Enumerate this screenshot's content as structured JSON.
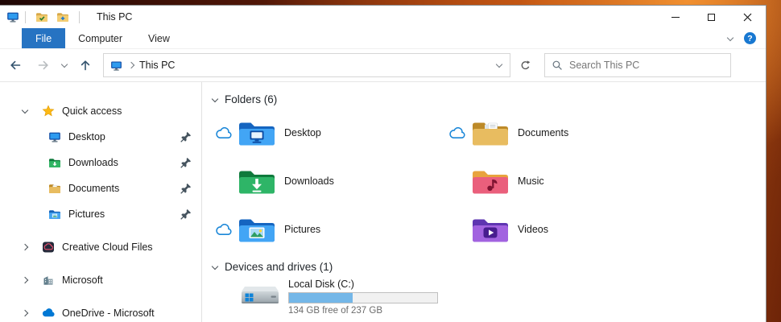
{
  "window": {
    "title": "This PC",
    "controls": {
      "minimize": "minimize",
      "maximize": "maximize",
      "close": "close"
    }
  },
  "ribbon": {
    "tabs": [
      {
        "id": "file",
        "label": "File",
        "active": true
      },
      {
        "id": "computer",
        "label": "Computer",
        "active": false
      },
      {
        "id": "view",
        "label": "View",
        "active": false
      }
    ],
    "help_label": "?"
  },
  "navbar": {
    "address_root": "This PC",
    "search_placeholder": "Search This PC"
  },
  "sidebar": {
    "items": [
      {
        "id": "quick-access",
        "label": "Quick access",
        "icon": "s-star",
        "chevron": "down",
        "pinned": false,
        "indent": false,
        "group": false
      },
      {
        "id": "desktop",
        "label": "Desktop",
        "icon": "i-pc",
        "chevron": "none",
        "pinned": true,
        "indent": true,
        "group": false
      },
      {
        "id": "downloads",
        "label": "Downloads",
        "icon": "s-downloads",
        "chevron": "none",
        "pinned": true,
        "indent": true,
        "group": false
      },
      {
        "id": "documents",
        "label": "Documents",
        "icon": "s-documents",
        "chevron": "none",
        "pinned": true,
        "indent": true,
        "group": false
      },
      {
        "id": "pictures",
        "label": "Pictures",
        "icon": "s-pictures",
        "chevron": "none",
        "pinned": true,
        "indent": true,
        "group": false
      },
      {
        "id": "creative-cloud-files",
        "label": "Creative Cloud Files",
        "icon": "s-cc",
        "chevron": "right",
        "pinned": false,
        "indent": false,
        "group": true
      },
      {
        "id": "microsoft",
        "label": "Microsoft",
        "icon": "s-ms",
        "chevron": "right",
        "pinned": false,
        "indent": false,
        "group": true
      },
      {
        "id": "onedrive-microsoft",
        "label": "OneDrive - Microsoft",
        "icon": "s-cloud",
        "chevron": "right",
        "pinned": false,
        "indent": false,
        "group": true
      }
    ]
  },
  "content": {
    "folders_section": {
      "title": "Folders (6)"
    },
    "folders": [
      {
        "id": "desktop",
        "name": "Desktop",
        "icon": "f-desktop",
        "cloud": true
      },
      {
        "id": "downloads",
        "name": "Downloads",
        "icon": "f-downloads",
        "cloud": false
      },
      {
        "id": "pictures",
        "name": "Pictures",
        "icon": "f-pictures",
        "cloud": true
      },
      {
        "id": "documents",
        "name": "Documents",
        "icon": "f-documents",
        "cloud": true
      },
      {
        "id": "music",
        "name": "Music",
        "icon": "f-music",
        "cloud": false
      },
      {
        "id": "videos",
        "name": "Videos",
        "icon": "f-videos",
        "cloud": false
      }
    ],
    "drives_section": {
      "title": "Devices and drives (1)"
    },
    "drives": [
      {
        "id": "local-disk-c",
        "name": "Local Disk (C:)",
        "icon": "drive-c",
        "free_text": "134 GB free of 237 GB",
        "used_percent": 43
      }
    ]
  },
  "colors": {
    "accent_blue": "#2673c2",
    "onedrive_blue": "#0078d4",
    "disk_bar_fill": "#74b7e8"
  }
}
